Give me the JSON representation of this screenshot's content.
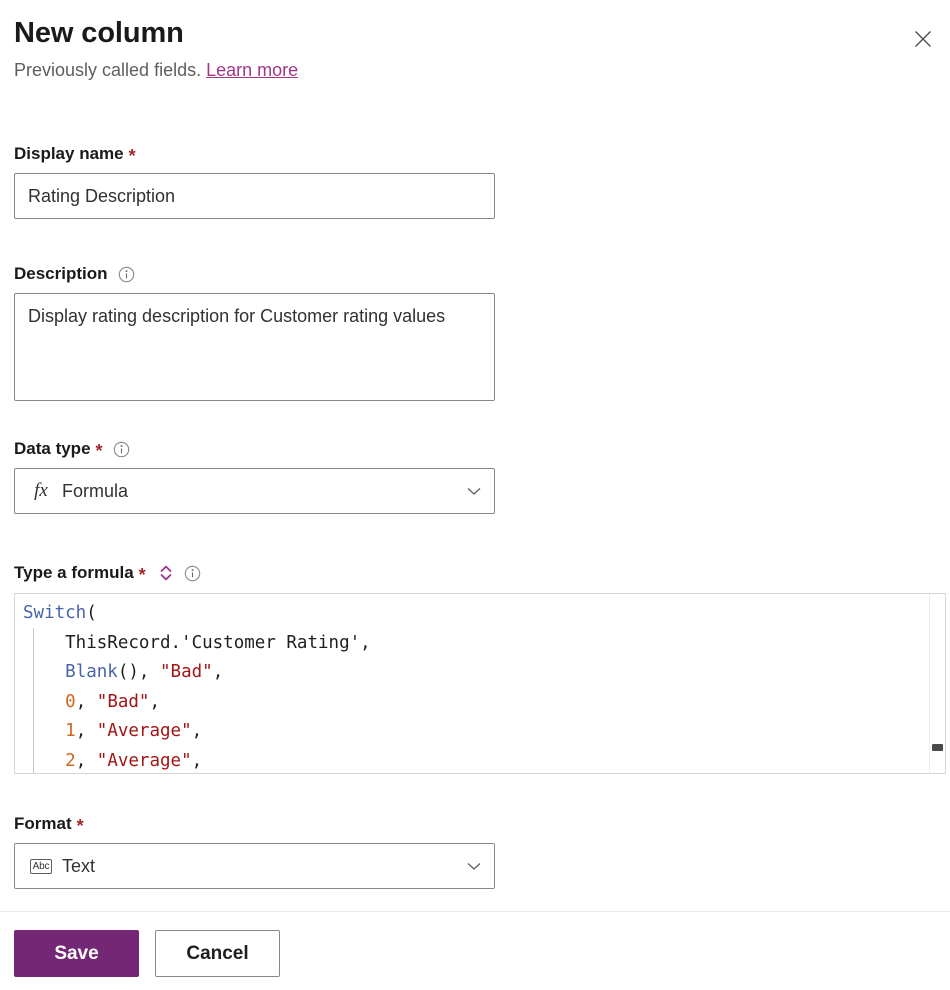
{
  "header": {
    "title": "New column",
    "subtitle_text": "Previously called fields.",
    "learn_more": "Learn more",
    "close_icon": "close-icon"
  },
  "fields": {
    "display_name": {
      "label": "Display name",
      "required_mark": "*",
      "value": "Rating Description",
      "placeholder": ""
    },
    "description": {
      "label": "Description",
      "info_icon": "info-icon",
      "value": "Display rating description for Customer rating values",
      "placeholder": ""
    },
    "data_type": {
      "label": "Data type",
      "required_mark": "*",
      "info_icon": "info-icon",
      "value": "Formula",
      "lead_icon": "fx-icon",
      "lead_text": "fx",
      "chevron_icon": "chevron-down-icon"
    },
    "formula": {
      "label": "Type a formula",
      "required_mark": "*",
      "expand_icon": "expand-collapse-icon",
      "info_icon": "info-icon",
      "lines": [
        [
          {
            "t": "Switch",
            "c": "fn"
          },
          {
            "t": "(",
            "c": "plain"
          }
        ],
        [
          {
            "t": "    ThisRecord.'Customer Rating',",
            "c": "plain"
          }
        ],
        [
          {
            "t": "    ",
            "c": "plain"
          },
          {
            "t": "Blank",
            "c": "fn"
          },
          {
            "t": "(), ",
            "c": "plain"
          },
          {
            "t": "\"Bad\"",
            "c": "str"
          },
          {
            "t": ",",
            "c": "plain"
          }
        ],
        [
          {
            "t": "    ",
            "c": "plain"
          },
          {
            "t": "0",
            "c": "num"
          },
          {
            "t": ", ",
            "c": "plain"
          },
          {
            "t": "\"Bad\"",
            "c": "str"
          },
          {
            "t": ",",
            "c": "plain"
          }
        ],
        [
          {
            "t": "    ",
            "c": "plain"
          },
          {
            "t": "1",
            "c": "num"
          },
          {
            "t": ", ",
            "c": "plain"
          },
          {
            "t": "\"Average\"",
            "c": "str"
          },
          {
            "t": ",",
            "c": "plain"
          }
        ],
        [
          {
            "t": "    ",
            "c": "plain"
          },
          {
            "t": "2",
            "c": "num"
          },
          {
            "t": ", ",
            "c": "plain"
          },
          {
            "t": "\"Average\"",
            "c": "str"
          },
          {
            "t": ",",
            "c": "plain"
          }
        ]
      ]
    },
    "format": {
      "label": "Format",
      "required_mark": "*",
      "value": "Text",
      "lead_icon": "abc-icon",
      "lead_text": "Abc",
      "chevron_icon": "chevron-down-icon"
    }
  },
  "footer": {
    "save_label": "Save",
    "cancel_label": "Cancel"
  },
  "colors": {
    "accent": "#742774",
    "link": "#a4368a",
    "required": "#a4262c",
    "code_function": "#4864aa",
    "code_number": "#d1661c",
    "code_string": "#a31515"
  }
}
